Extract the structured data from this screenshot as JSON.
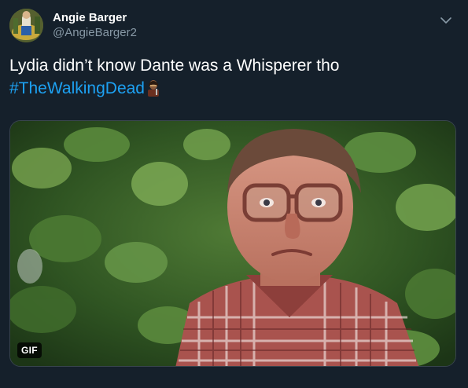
{
  "tweet": {
    "author": {
      "display_name": "Angie Barger",
      "handle": "@AngieBarger2",
      "avatar_icon": "profile-photo"
    },
    "menu_icon": "chevron-down-icon",
    "text": "Lydia didn’t know Dante was a Whisperer tho",
    "hashtag": "#TheWalkingDead",
    "hashtag_emoji": "walking-dead-character-emoji",
    "media": {
      "type": "gif",
      "badge_label": "GIF",
      "description_icon": "gif-thumbnail"
    }
  },
  "colors": {
    "background": "#15202b",
    "text": "#ffffff",
    "secondary_text": "#8899a6",
    "link": "#1da1f2",
    "border": "#38444d"
  }
}
